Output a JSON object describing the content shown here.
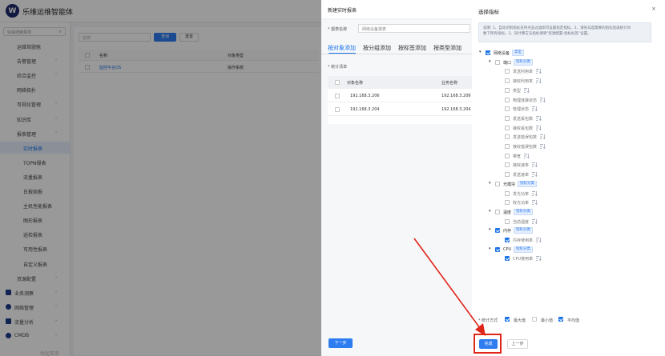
{
  "app": {
    "title": "乐维运维智能体"
  },
  "sidebar": {
    "search_placeholder": "快速搜索菜单",
    "items": [
      {
        "label": "运维驾驶舱",
        "chev": false,
        "active": false,
        "icon": ""
      },
      {
        "label": "告警管理",
        "chev": true,
        "active": false,
        "icon": ""
      },
      {
        "label": "综合监控",
        "chev": true,
        "active": false,
        "icon": ""
      },
      {
        "label": "网络拓扑",
        "chev": false,
        "active": false,
        "icon": ""
      },
      {
        "label": "可视化管理",
        "chev": true,
        "active": false,
        "icon": ""
      },
      {
        "label": "知识库",
        "chev": true,
        "active": false,
        "icon": ""
      },
      {
        "label": "报表管理",
        "chev": true,
        "active": false,
        "icon": ""
      },
      {
        "label": "实时报表",
        "chev": false,
        "active": true,
        "icon": "",
        "sub": true
      },
      {
        "label": "TOPN报表",
        "chev": false,
        "active": false,
        "icon": "",
        "sub": true
      },
      {
        "label": "流量报表",
        "chev": false,
        "active": false,
        "icon": "",
        "sub": true
      },
      {
        "label": "日报周报",
        "chev": false,
        "active": false,
        "icon": "",
        "sub": true
      },
      {
        "label": "主机性能报表",
        "chev": false,
        "active": false,
        "icon": "",
        "sub": true
      },
      {
        "label": "图形报表",
        "chev": false,
        "active": false,
        "icon": "",
        "sub": true
      },
      {
        "label": "巡检报表",
        "chev": false,
        "active": false,
        "icon": "",
        "sub": true
      },
      {
        "label": "可用性报表",
        "chev": false,
        "active": false,
        "icon": "",
        "sub": true
      },
      {
        "label": "自定义报表",
        "chev": false,
        "active": false,
        "icon": "",
        "sub": true
      },
      {
        "label": "资源配置",
        "chev": true,
        "active": false,
        "icon": ""
      },
      {
        "label": "业务洞察",
        "chev": true,
        "active": false,
        "icon": "square"
      },
      {
        "label": "网络管理",
        "chev": true,
        "active": false,
        "icon": "round"
      },
      {
        "label": "流量分析",
        "chev": true,
        "active": false,
        "icon": "square"
      },
      {
        "label": "CMDB",
        "chev": true,
        "active": false,
        "icon": "round"
      }
    ],
    "bottom_label": "收起菜单"
  },
  "content": {
    "name_placeholder": "名称",
    "query_label": "查询",
    "reset_label": "重置",
    "columns": [
      "名称",
      "对象类型"
    ],
    "rows": [
      {
        "name": "监控平台OS",
        "type": "操作系统"
      }
    ]
  },
  "drawer": {
    "title": "新建实时报表",
    "form": {
      "label": "* 报表名称",
      "value": "网络设备报表"
    },
    "tabs": [
      "按对象添加",
      "按分组添加",
      "按标签添加",
      "按类型添加"
    ],
    "stat_label": "* 统计清单",
    "columns": [
      "对象名称",
      "业务名称"
    ],
    "rows": [
      {
        "ip": "192.168.3.206",
        "biz": "192.168.3.206"
      },
      {
        "ip": "192.168.3.204",
        "biz": "192.168.3.204"
      }
    ],
    "next_label": "下一步"
  },
  "panel": {
    "title": "选择指标",
    "close": "×",
    "desc": [
      "说明: 1、自动识别指标支持点击过滤即可设置指定指标。2、请先勾选需要的指标后再统计对",
      "象下所有指标。3、同计算方法指标请到\"资源配置-指标标签\"设置。"
    ],
    "tree": [
      {
        "depth": 0,
        "arrow": true,
        "checked": true,
        "label": "网络设备",
        "tag": "类型"
      },
      {
        "depth": 1,
        "arrow": true,
        "checked": false,
        "label": "端口",
        "tag": "指标分类"
      },
      {
        "depth": 2,
        "checked": false,
        "label": "发送利用率",
        "sort": true
      },
      {
        "depth": 2,
        "checked": false,
        "label": "接收利用率",
        "sort": true
      },
      {
        "depth": 2,
        "checked": false,
        "label": "类型",
        "sort": true
      },
      {
        "depth": 2,
        "checked": false,
        "label": "物理连接状态",
        "sort": true
      },
      {
        "depth": 2,
        "checked": false,
        "label": "管理状态",
        "sort": true
      },
      {
        "depth": 2,
        "checked": false,
        "label": "发送丢包数",
        "sort": true
      },
      {
        "depth": 2,
        "checked": false,
        "label": "接收丢包数",
        "sort": true
      },
      {
        "depth": 2,
        "checked": false,
        "label": "发送错误包数",
        "sort": true
      },
      {
        "depth": 2,
        "checked": false,
        "label": "接收错误包数",
        "sort": true
      },
      {
        "depth": 2,
        "checked": false,
        "label": "带宽",
        "sort": true
      },
      {
        "depth": 2,
        "checked": false,
        "label": "接收速率",
        "sort": true
      },
      {
        "depth": 2,
        "checked": false,
        "label": "发送速率",
        "sort": true
      },
      {
        "depth": 1,
        "arrow": true,
        "checked": false,
        "label": "光模块",
        "tag": "指标分类"
      },
      {
        "depth": 2,
        "checked": false,
        "label": "发光功率",
        "sort": true
      },
      {
        "depth": 2,
        "checked": false,
        "label": "收光功率",
        "sort": true
      },
      {
        "depth": 1,
        "arrow": true,
        "checked": false,
        "label": "温度",
        "tag": "指标分类"
      },
      {
        "depth": 2,
        "checked": false,
        "label": "当前温度",
        "sort": true
      },
      {
        "depth": 1,
        "arrow": true,
        "checked": true,
        "label": "内存",
        "tag": "指标分类"
      },
      {
        "depth": 2,
        "checked": true,
        "label": "内存使用率",
        "sort": true
      },
      {
        "depth": 1,
        "arrow": true,
        "checked": true,
        "label": "CPU",
        "tag": "指标分类"
      },
      {
        "depth": 2,
        "checked": true,
        "label": "CPU使用率",
        "sort": true
      }
    ],
    "stat_method": {
      "label": "* 统计方式",
      "options": [
        {
          "label": "最大值",
          "checked": true
        },
        {
          "label": "最小值",
          "checked": false
        },
        {
          "label": "平均值",
          "checked": true
        }
      ]
    },
    "done_label": "完成",
    "prev_label": "上一步"
  },
  "colors": {
    "accent": "#1a73e8",
    "highlight": "#e0251b",
    "tag_bg": "#e6effd"
  }
}
